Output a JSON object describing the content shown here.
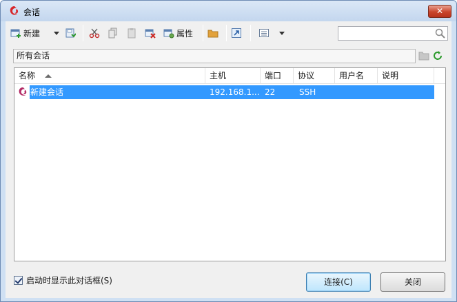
{
  "window": {
    "title": "会话"
  },
  "toolbar": {
    "new_label": "新建",
    "properties_label": "属性",
    "search": {
      "value": "",
      "placeholder": ""
    }
  },
  "path": {
    "current": "所有会话"
  },
  "list": {
    "columns": [
      "名称",
      "主机",
      "端口",
      "协议",
      "用户名",
      "说明"
    ],
    "sorted_column": "名称",
    "rows": [
      {
        "name": "新建会话",
        "host": "192.168.1...",
        "port": "22",
        "protocol": "SSH",
        "user": "",
        "description": ""
      }
    ]
  },
  "footer": {
    "show_on_startup_label": "启动时显示此对话框(S)",
    "show_on_startup_checked": true,
    "connect_label": "连接(C)",
    "close_label": "关闭"
  },
  "colors": {
    "selection": "#3399ff",
    "titlebar": "#c3d6ee",
    "close": "#c9442b"
  }
}
